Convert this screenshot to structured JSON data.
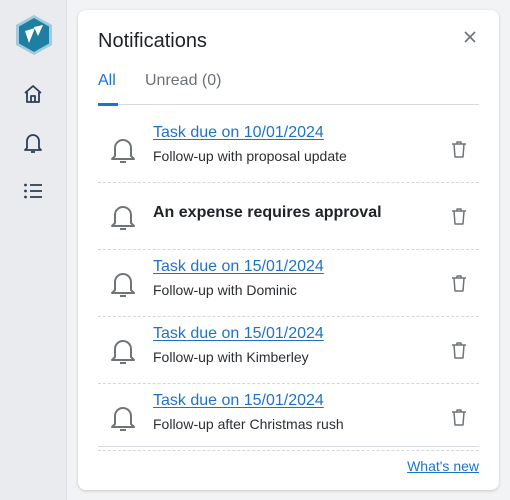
{
  "sidebar": {
    "logo": "app-logo",
    "items": [
      {
        "icon": "home-icon",
        "label": "Home"
      },
      {
        "icon": "bell-icon",
        "label": "Notifications"
      },
      {
        "icon": "list-icon",
        "label": "Tasks"
      }
    ]
  },
  "panel": {
    "title": "Notifications",
    "close_icon": "close-icon",
    "tabs": [
      {
        "label": "All",
        "active": true
      },
      {
        "label": "Unread (0)",
        "active": false
      }
    ],
    "notifications": [
      {
        "heading": "Task due on 10/01/2024",
        "body": "Follow-up with proposal update",
        "link": true
      },
      {
        "heading": "An expense requires approval",
        "body": "",
        "link": false
      },
      {
        "heading": "Task due on 15/01/2024",
        "body": "Follow-up with Dominic",
        "link": true
      },
      {
        "heading": "Task due on 15/01/2024",
        "body": "Follow-up with Kimberley",
        "link": true
      },
      {
        "heading": "Task due on 15/01/2024",
        "body": "Follow-up after Christmas rush",
        "link": true
      }
    ],
    "footer_link": "What's new"
  },
  "colors": {
    "accent": "#1f73c6",
    "logo": "#1e7fa3"
  }
}
